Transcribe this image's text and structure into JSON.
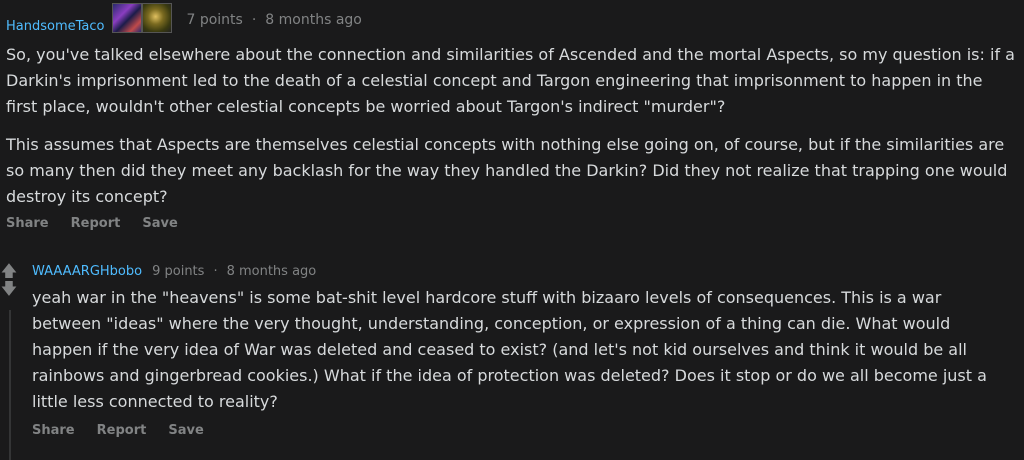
{
  "comments": [
    {
      "username": "HandsomeTaco",
      "points": "7 points",
      "separator": "·",
      "time": "8 months ago",
      "paragraphs": [
        "So, you've talked elsewhere about the connection and similarities of Ascended and the mortal Aspects, so my question is: if a Darkin's imprisonment led to the death of a celestial concept and Targon engineering that imprisonment to happen in the first place, wouldn't other celestial concepts be worried about Targon's indirect \"murder\"?",
        "This assumes that Aspects are themselves celestial concepts with nothing else going on, of course, but if the similarities are so many then did they meet any backlash for the way they handled the Darkin? Did they not realize that trapping one would destroy its concept?"
      ],
      "actions": {
        "share": "Share",
        "report": "Report",
        "save": "Save"
      }
    },
    {
      "username": "WAAAARGHbobo",
      "points": "9 points",
      "separator": "·",
      "time": "8 months ago",
      "paragraphs": [
        "yeah war in the \"heavens\" is some bat-shit level hardcore stuff with bizaaro levels of consequences. This is a war between \"ideas\" where the very thought, understanding, conception, or expression of a thing can die. What would happen if the very idea of War was deleted and ceased to exist? (and let's not kid ourselves and think it would be all rainbows and gingerbread cookies.) What if the idea of protection was deleted? Does it stop or do we all become just a little less connected to reality?"
      ],
      "actions": {
        "share": "Share",
        "report": "Report",
        "save": "Save"
      },
      "icons": {
        "upvote": "upvote-arrow",
        "downvote": "downvote-arrow"
      }
    }
  ]
}
